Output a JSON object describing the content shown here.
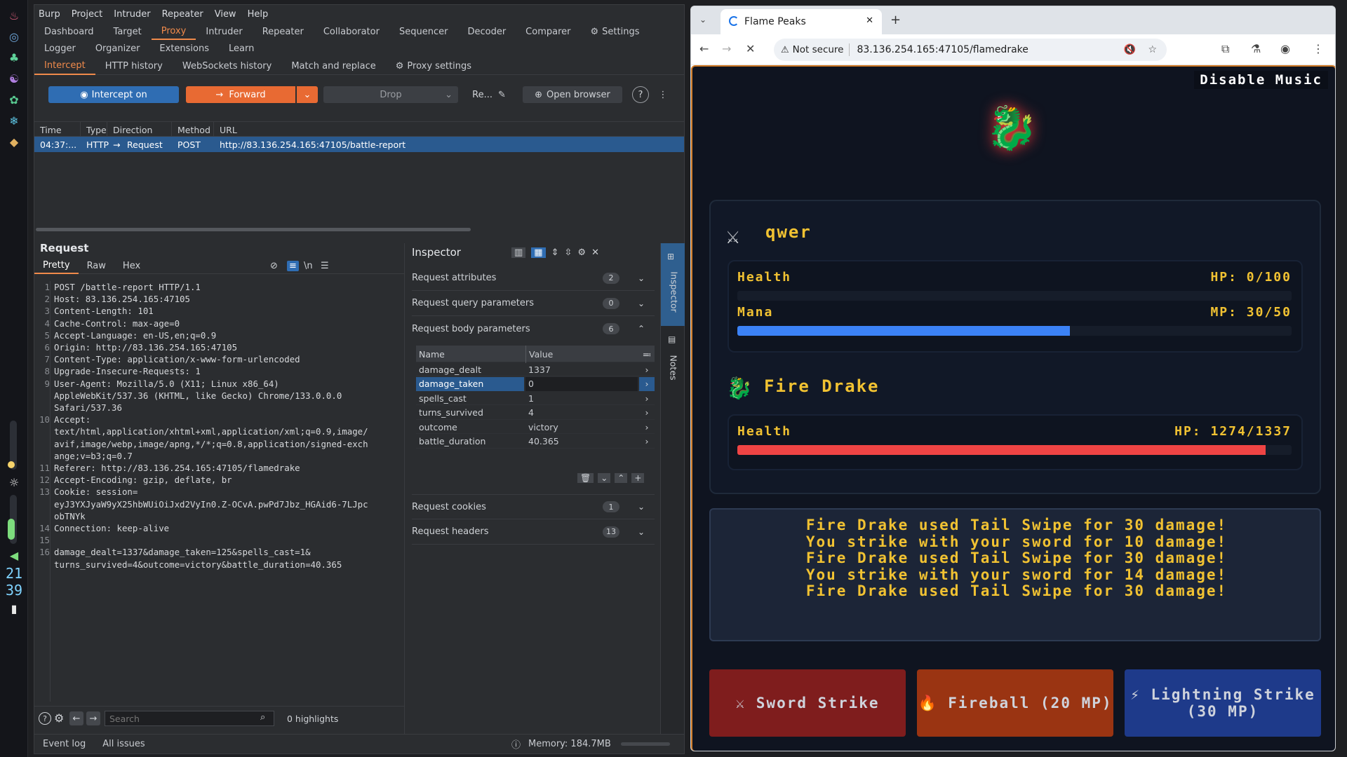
{
  "dock": {
    "clock_hour": "21",
    "clock_min": "39"
  },
  "burp": {
    "menu": [
      "Burp",
      "Project",
      "Intruder",
      "Repeater",
      "View",
      "Help"
    ],
    "tabs_row1": [
      "Dashboard",
      "Target",
      "Proxy",
      "Intruder",
      "Repeater",
      "Collaborator",
      "Sequencer",
      "Decoder",
      "Comparer"
    ],
    "settings_label": "Settings",
    "tabs_row2": [
      "Logger",
      "Organizer",
      "Extensions",
      "Learn"
    ],
    "proxy_tabs": [
      "Intercept",
      "HTTP history",
      "WebSockets history",
      "Match and replace"
    ],
    "proxy_settings_label": "Proxy settings",
    "intercept_label": "Intercept on",
    "forward_label": "Forward",
    "drop_label": "Drop",
    "re_label": "Re...",
    "open_browser_label": "Open browser",
    "history_headers": [
      "Time",
      "Type",
      "Direction",
      "Method",
      "URL"
    ],
    "history_row": {
      "time": "04:37:...",
      "type": "HTTP",
      "arrow": "→",
      "direction": "Request",
      "method": "POST",
      "url": "http://83.136.254.165:47105/battle-report"
    },
    "request_title": "Request",
    "request_tabs": [
      "Pretty",
      "Raw",
      "Hex"
    ],
    "request_lines": [
      {
        "n": "1",
        "text": "POST /battle-report HTTP/1.1"
      },
      {
        "n": "2",
        "text": "Host: 83.136.254.165:47105"
      },
      {
        "n": "3",
        "text": "Content-Length: 101"
      },
      {
        "n": "4",
        "text": "Cache-Control: max-age=0"
      },
      {
        "n": "5",
        "text": "Accept-Language: en-US,en;q=0.9"
      },
      {
        "n": "6",
        "text": "Origin: http://83.136.254.165:47105"
      },
      {
        "n": "7",
        "text": "Content-Type: application/x-www-form-urlencoded"
      },
      {
        "n": "8",
        "text": "Upgrade-Insecure-Requests: 1"
      },
      {
        "n": "9",
        "text": "User-Agent: Mozilla/5.0 (X11; Linux x86_64)"
      },
      {
        "n": "",
        "text": "AppleWebKit/537.36 (KHTML, like Gecko) Chrome/133.0.0.0"
      },
      {
        "n": "",
        "text": "Safari/537.36"
      },
      {
        "n": "10",
        "text": "Accept:"
      },
      {
        "n": "",
        "text": "text/html,application/xhtml+xml,application/xml;q=0.9,image/"
      },
      {
        "n": "",
        "text": "avif,image/webp,image/apng,*/*;q=0.8,application/signed-exch"
      },
      {
        "n": "",
        "text": "ange;v=b3;q=0.7"
      },
      {
        "n": "11",
        "text": "Referer: http://83.136.254.165:47105/flamedrake"
      },
      {
        "n": "12",
        "text": "Accept-Encoding: gzip, deflate, br"
      },
      {
        "n": "13",
        "text": "Cookie: session="
      },
      {
        "n": "",
        "text": "eyJ3YXJyaW9yX25hbWUiOiJxd2VyIn0.Z-OCvA.pwPd7Jbz_HGAid6-7LJpc"
      },
      {
        "n": "",
        "text": "obTNYk"
      },
      {
        "n": "14",
        "text": "Connection: keep-alive"
      },
      {
        "n": "15",
        "text": ""
      },
      {
        "n": "16",
        "text": "damage_dealt=1337&damage_taken=125&spells_cast=1&"
      },
      {
        "n": "",
        "text": "turns_survived=4&outcome=victory&battle_duration=40.365"
      }
    ],
    "search_placeholder": "Search",
    "highlights": "0 highlights",
    "inspector_title": "Inspector",
    "sections": [
      {
        "label": "Request attributes",
        "count": "2"
      },
      {
        "label": "Request query parameters",
        "count": "0"
      },
      {
        "label": "Request body parameters",
        "count": "6"
      }
    ],
    "param_headers": [
      "Name",
      "Value"
    ],
    "params": [
      {
        "name": "damage_dealt",
        "value": "1337"
      },
      {
        "name": "damage_taken",
        "value": "0"
      },
      {
        "name": "spells_cast",
        "value": "1"
      },
      {
        "name": "turns_survived",
        "value": "4"
      },
      {
        "name": "outcome",
        "value": "victory"
      },
      {
        "name": "battle_duration",
        "value": "40.365"
      }
    ],
    "cookies_section": {
      "label": "Request cookies",
      "count": "1"
    },
    "headers_section": {
      "label": "Request headers",
      "count": "13"
    },
    "side_inspector": "Inspector",
    "side_notes": "Notes",
    "event_log": "Event log",
    "all_issues": "All issues",
    "memory": "Memory: 184.7MB"
  },
  "browser": {
    "tab_title": "Flame Peaks",
    "not_secure": "Not secure",
    "url": "83.136.254.165:47105/flamedrake",
    "game": {
      "music_button": "Disable Music",
      "player_name": "qwer",
      "health_label": "Health",
      "player_hp": "HP: 0/100",
      "mana_label": "Mana",
      "player_mp": "MP: 30/50",
      "mana_fraction": 0.6,
      "enemy_name": "Fire Drake",
      "enemy_hp": "HP: 1274/1337",
      "enemy_fraction": 0.953,
      "log": [
        "Fire Drake used Tail Swipe for 30 damage!",
        "You strike with your sword for 10 damage!",
        "Fire Drake used Tail Swipe for 30 damage!",
        "You strike with your sword for 14 damage!",
        "Fire Drake used Tail Swipe for 30 damage!"
      ],
      "actions": [
        {
          "icon": "⚔",
          "label": "Sword Strike"
        },
        {
          "icon": "🔥",
          "label": "Fireball (20 MP)"
        },
        {
          "icon": "⚡",
          "label": "Lightning Strike (30 MP)"
        }
      ]
    }
  }
}
